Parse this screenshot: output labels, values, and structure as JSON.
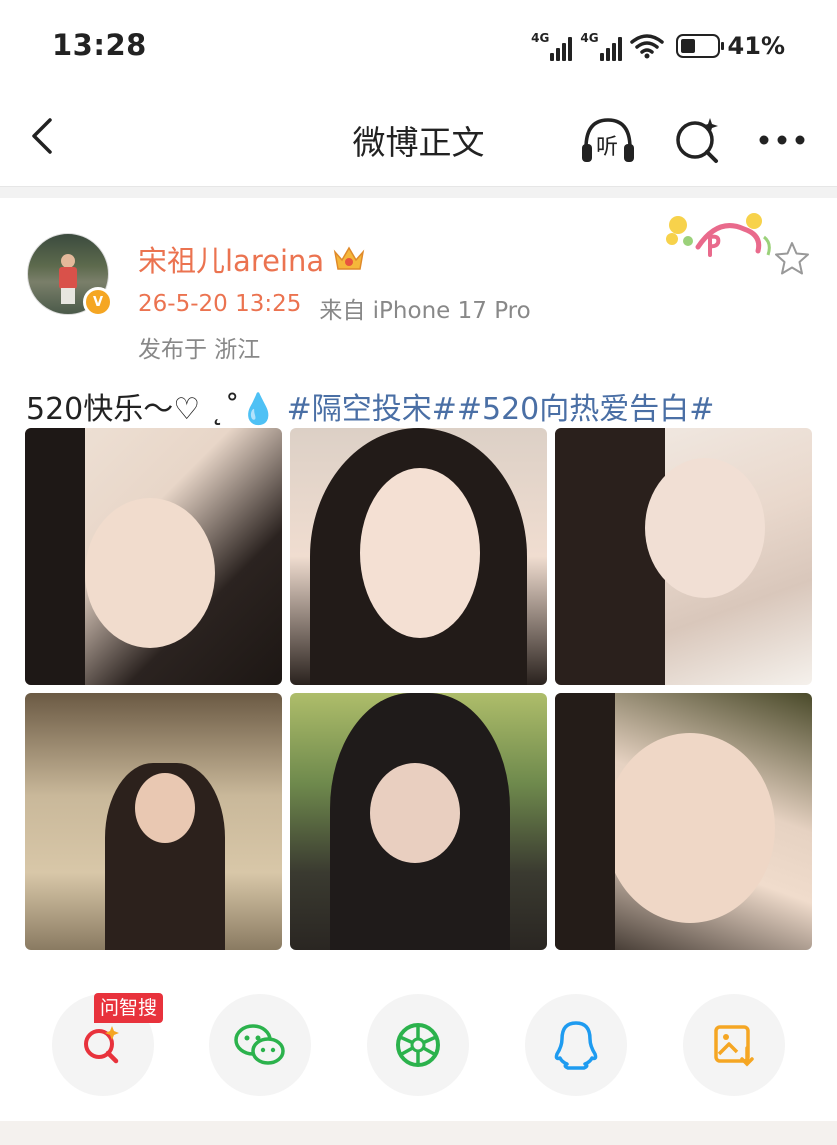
{
  "status_bar": {
    "time": "13:28",
    "network1": "4G",
    "network2": "4G",
    "battery_level": 0.41,
    "battery_text": "41%"
  },
  "nav": {
    "title": "微博正文",
    "back_icon": "chevron-left-icon",
    "listen_label": "听",
    "search_icon": "ai-search-icon",
    "more_icon": "more-dots-icon"
  },
  "post": {
    "username": "宋祖儿lareina",
    "timestamp": "26-5-20 13:25",
    "source": "来自 iPhone 17 Pro",
    "location": "发布于 浙江",
    "text": "520快乐～♡ ˛˚💧 ",
    "hashtags": [
      "#隔空投宋#",
      "#520向热爱告白#"
    ],
    "photo_count": 6
  },
  "share": {
    "badge": "问智搜",
    "items": [
      "ai-search",
      "wechat",
      "moments",
      "qq",
      "save-image"
    ]
  },
  "colors": {
    "accent": "#eb7350",
    "link": "#4a6fa5",
    "badge": "#e8323c"
  }
}
